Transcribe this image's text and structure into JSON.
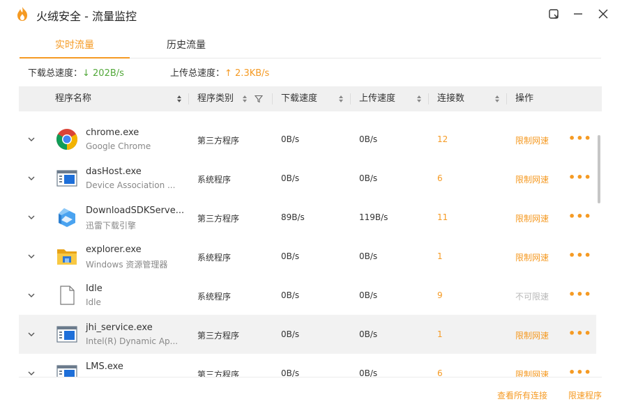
{
  "app": {
    "title": "火绒安全 - 流量监控",
    "accent": "#f59a23",
    "download_color": "#52a83a"
  },
  "window_controls": {
    "icons": [
      "pin-icon",
      "minimize-icon",
      "close-icon"
    ]
  },
  "tabs": [
    {
      "label": "实时流量",
      "active": true
    },
    {
      "label": "历史流量",
      "active": false
    }
  ],
  "speeds": {
    "download_label": "下载总速度：",
    "download_value": "↓ 202B/s",
    "upload_label": "上传总速度：",
    "upload_value": "↑ 2.3KB/s"
  },
  "columns": {
    "name": "程序名称",
    "type": "程序类别",
    "download": "下载速度",
    "upload": "上传速度",
    "connections": "连接数",
    "action": "操作"
  },
  "rows": [
    {
      "name": "chrome.exe",
      "desc": "Google Chrome",
      "type": "第三方程序",
      "dl": "0B/s",
      "ul": "0B/s",
      "conn": "12",
      "action": "限制网速",
      "icon": "chrome-icon",
      "more": "•••"
    },
    {
      "name": "dasHost.exe",
      "desc": "Device Association ...",
      "type": "系统程序",
      "dl": "0B/s",
      "ul": "0B/s",
      "conn": "6",
      "action": "限制网速",
      "icon": "window-app-icon",
      "more": "•••"
    },
    {
      "name": "DownloadSDKServe...",
      "desc": "迅雷下载引擎",
      "type": "第三方程序",
      "dl": "89B/s",
      "ul": "119B/s",
      "conn": "11",
      "action": "限制网速",
      "icon": "xunlei-icon",
      "more": "•••"
    },
    {
      "name": "explorer.exe",
      "desc": "Windows 资源管理器",
      "type": "系统程序",
      "dl": "0B/s",
      "ul": "0B/s",
      "conn": "1",
      "action": "限制网速",
      "icon": "folder-icon",
      "more": "•••"
    },
    {
      "name": "Idle",
      "desc": "Idle",
      "type": "系统程序",
      "dl": "0B/s",
      "ul": "0B/s",
      "conn": "9",
      "action": "不可限速",
      "icon": "blank-file-icon",
      "more": "•••"
    },
    {
      "name": "jhi_service.exe",
      "desc": "Intel(R) Dynamic Ap...",
      "type": "第三方程序",
      "dl": "0B/s",
      "ul": "0B/s",
      "conn": "1",
      "action": "限制网速",
      "icon": "window-app-icon",
      "more": "•••"
    },
    {
      "name": "LMS.exe",
      "desc": "",
      "type": "第三方程序",
      "dl": "0B/s",
      "ul": "0B/s",
      "conn": "6",
      "action": "限制网速",
      "icon": "window-app-icon",
      "more": "•••"
    }
  ],
  "footer": {
    "view_all": "查看所有连接",
    "limit_program": "限速程序"
  }
}
